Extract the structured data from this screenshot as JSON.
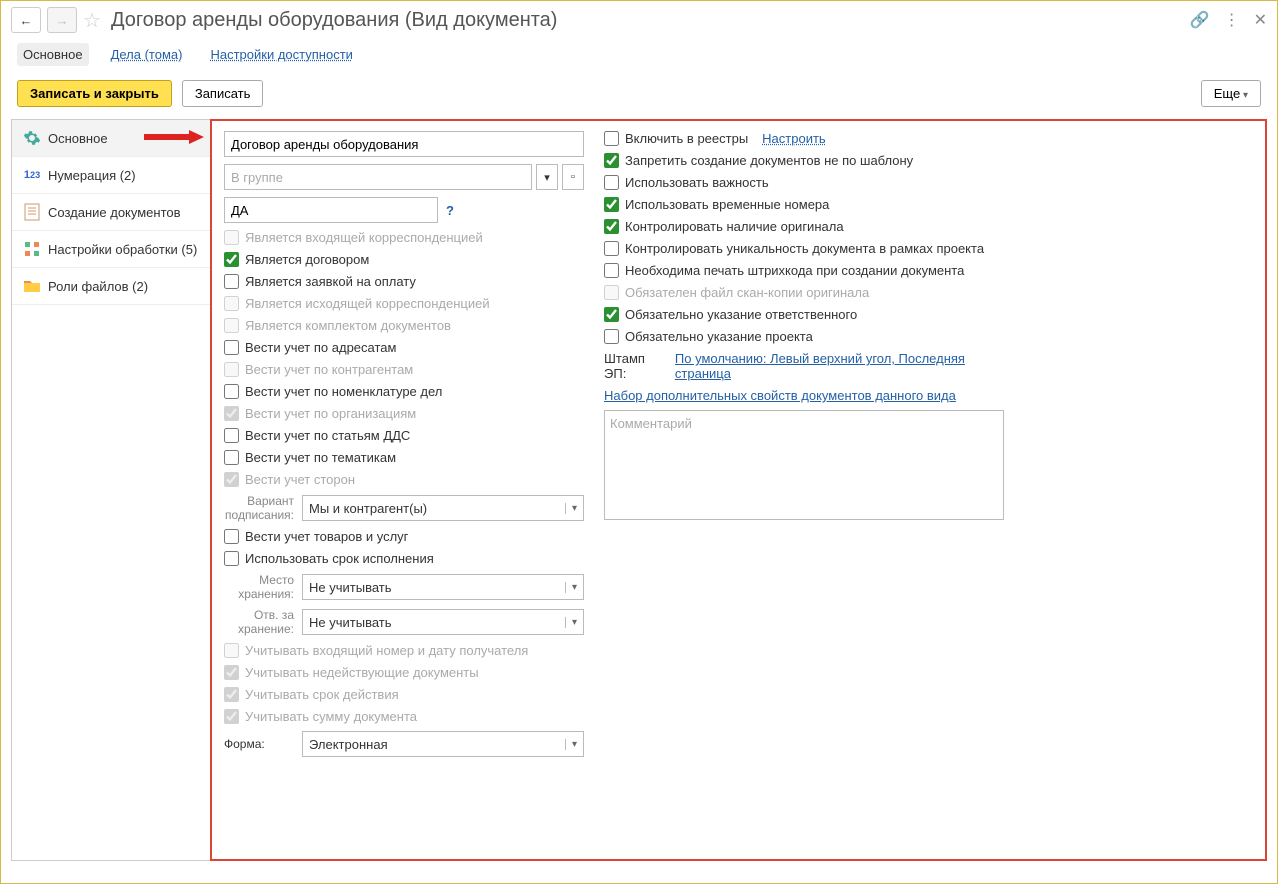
{
  "header": {
    "title": "Договор аренды оборудования (Вид документа)"
  },
  "tabs": {
    "main": "Основное",
    "cases": "Дела (тома)",
    "access": "Настройки доступности"
  },
  "toolbar": {
    "save_close": "Записать и закрыть",
    "save": "Записать",
    "more": "Еще"
  },
  "sidebar": {
    "main": "Основное",
    "numbering": "Нумерация (2)",
    "doc_creation": "Создание документов",
    "processing": "Настройки обработки (5)",
    "file_roles": "Роли файлов (2)"
  },
  "form": {
    "name_value": "Договор аренды оборудования",
    "group_placeholder": "В группе",
    "code_value": "ДА",
    "cb_incoming": "Является входящей корреспонденцией",
    "cb_contract": "Является договором",
    "cb_payment": "Является заявкой на оплату",
    "cb_outgoing": "Является исходящей корреспонденцией",
    "cb_docset": "Является комплектом документов",
    "cb_addressee": "Вести учет по адресатам",
    "cb_counterparty": "Вести учет по контрагентам",
    "cb_nomenclature": "Вести учет по номенклатуре дел",
    "cb_org": "Вести учет по организациям",
    "cb_dds": "Вести учет по статьям ДДС",
    "cb_topics": "Вести учет по тематикам",
    "cb_parties": "Вести учет сторон",
    "signing_label": "Вариант подписания:",
    "signing_value": "Мы и контрагент(ы)",
    "cb_goods": "Вести учет товаров и услуг",
    "cb_deadline": "Использовать срок исполнения",
    "storage_label": "Место хранения:",
    "storage_value": "Не учитывать",
    "resp_storage_label": "Отв. за хранение:",
    "resp_storage_value": "Не учитывать",
    "cb_incoming_num": "Учитывать входящий номер и дату получателя",
    "cb_inactive": "Учитывать недействующие документы",
    "cb_validity": "Учитывать срок действия",
    "cb_amount": "Учитывать сумму документа",
    "form_label": "Форма:",
    "form_value": "Электронная",
    "cb_registry": "Включить в реестры",
    "setup_link": "Настроить",
    "cb_template_only": "Запретить создание документов не по шаблону",
    "cb_importance": "Использовать важность",
    "cb_temp_num": "Использовать временные номера",
    "cb_original": "Контролировать наличие оригинала",
    "cb_unique": "Контролировать уникальность документа в рамках проекта",
    "cb_barcode": "Необходима печать штрихкода при создании документа",
    "cb_scan": "Обязателен файл скан-копии оригинала",
    "cb_responsible": "Обязательно указание ответственного",
    "cb_project": "Обязательно указание проекта",
    "stamp_label": "Штамп ЭП:",
    "stamp_value": "По умолчанию: Левый верхний угол, Последняя страница",
    "extra_props": "Набор дополнительных свойств документов данного вида",
    "comment_placeholder": "Комментарий"
  }
}
